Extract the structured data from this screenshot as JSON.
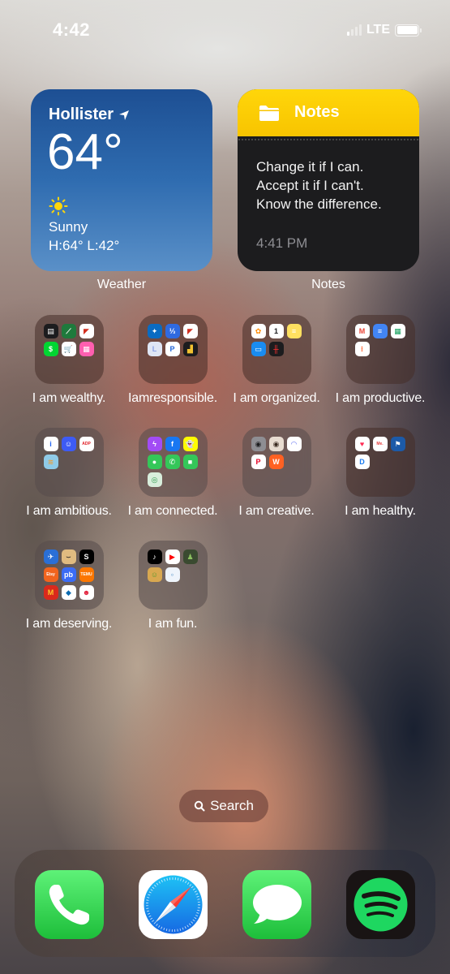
{
  "status_bar": {
    "time": "4:42",
    "network": "LTE",
    "signal_bars_active": 1,
    "signal_bars_total": 4,
    "battery_level": 1.0
  },
  "widgets": {
    "weather": {
      "city": "Hollister",
      "location_icon": "location-arrow-icon",
      "temperature": "64°",
      "condition_icon": "sun-icon",
      "condition": "Sunny",
      "high_low": "H:64° L:42°",
      "label": "Weather"
    },
    "notes": {
      "header": "Notes",
      "header_icon": "folder-icon",
      "lines": [
        "Change it if I can.",
        "Accept it if I can't.",
        "Know the difference."
      ],
      "timestamp": "4:41 PM",
      "label": "Notes"
    }
  },
  "folders": [
    {
      "label": "I am wealthy.",
      "apps": [
        {
          "name": "Wallet",
          "icon": "wallet-icon",
          "bg": "#1c1c1e",
          "glyph": "▤"
        },
        {
          "name": "Fifth Third Bank",
          "icon": "bank-icon",
          "bg": "#1e7a3c",
          "glyph": "⟋"
        },
        {
          "name": "Capital One",
          "icon": "capital-one-icon",
          "bg": "#ffffff",
          "glyph": "◤",
          "fg": "#d22e1e"
        },
        {
          "name": "Cash App",
          "icon": "cash-app-icon",
          "bg": "#00d632",
          "glyph": "$"
        },
        {
          "name": "Shopping Cart",
          "icon": "cart-icon",
          "bg": "#ffffff",
          "glyph": "🛒",
          "fg": "#2a4a8a"
        },
        {
          "name": "Store",
          "icon": "store-icon",
          "bg": "#ff5fb0",
          "glyph": "▦"
        }
      ]
    },
    {
      "label": "Iamresponsible.",
      "apps": [
        {
          "name": "Credit Karma",
          "icon": "shield-icon",
          "bg": "#0a6bc2",
          "glyph": "✦"
        },
        {
          "name": "Split",
          "icon": "split-icon",
          "bg": "#2f6ae0",
          "glyph": "⅓"
        },
        {
          "name": "Capital One",
          "icon": "capital-one-icon",
          "bg": "#ffffff",
          "glyph": "◤",
          "fg": "#d22e1e"
        },
        {
          "name": "L App",
          "icon": "l-icon",
          "bg": "#dfe6f5",
          "glyph": "L",
          "fg": "#8aa0e6"
        },
        {
          "name": "PayPal",
          "icon": "paypal-icon",
          "bg": "#ffffff",
          "glyph": "P",
          "fg": "#1f63d6"
        },
        {
          "name": "Chart App",
          "icon": "bar-chart-icon",
          "bg": "#1c1c1e",
          "glyph": "▟",
          "fg": "#f2c230"
        }
      ]
    },
    {
      "label": "I am organized.",
      "apps": [
        {
          "name": "Photos",
          "icon": "photos-icon",
          "bg": "#ffffff",
          "glyph": "✿",
          "fg": "#ff8a00"
        },
        {
          "name": "Calendar",
          "icon": "calendar-icon",
          "bg": "#ffffff",
          "glyph": "1",
          "fg": "#1c1c1e"
        },
        {
          "name": "Notes",
          "icon": "notes-icon",
          "bg": "#ffe060",
          "glyph": "≡",
          "fg": "#ffffff"
        },
        {
          "name": "Files",
          "icon": "files-icon",
          "bg": "#1a8cf0",
          "glyph": "▭"
        },
        {
          "name": "Voice Memos",
          "icon": "voice-memos-icon",
          "bg": "#1c1c1e",
          "glyph": "╫",
          "fg": "#ff3030"
        }
      ]
    },
    {
      "label": "I am productive.",
      "apps": [
        {
          "name": "Gmail",
          "icon": "gmail-icon",
          "bg": "#ffffff",
          "glyph": "M",
          "fg": "#ea4335"
        },
        {
          "name": "Google Docs",
          "icon": "docs-icon",
          "bg": "#4285f4",
          "glyph": "≡"
        },
        {
          "name": "Google Sheets",
          "icon": "sheets-icon",
          "bg": "#ffffff",
          "glyph": "▦",
          "fg": "#0f9d58"
        },
        {
          "name": "Reminders",
          "icon": "reminders-icon",
          "bg": "#ffffff",
          "glyph": "⁝",
          "fg": "#ff6b3a"
        }
      ]
    },
    {
      "label": "I am ambitious.",
      "apps": [
        {
          "name": "Indeed",
          "icon": "indeed-icon",
          "bg": "#ffffff",
          "glyph": "i",
          "fg": "#2164f3"
        },
        {
          "name": "Handshake",
          "icon": "robot-icon",
          "bg": "#3d5bf5",
          "glyph": "☺"
        },
        {
          "name": "ADP",
          "icon": "adp-icon",
          "bg": "#ffffff",
          "glyph": "ADP",
          "fg": "#e01b22"
        },
        {
          "name": "Planner",
          "icon": "planner-icon",
          "bg": "#8fcbe8",
          "glyph": "≋",
          "fg": "#e8a040"
        }
      ]
    },
    {
      "label": "I am connected.",
      "apps": [
        {
          "name": "Messenger",
          "icon": "messenger-icon",
          "bg": "#a24bf5",
          "glyph": "ϟ"
        },
        {
          "name": "Facebook",
          "icon": "facebook-icon",
          "bg": "#1877f2",
          "glyph": "f"
        },
        {
          "name": "Snapchat",
          "icon": "snapchat-icon",
          "bg": "#fffc00",
          "glyph": "👻",
          "fg": "#000"
        },
        {
          "name": "Messages",
          "icon": "messages-icon",
          "bg": "#34c759",
          "glyph": "●"
        },
        {
          "name": "Phone",
          "icon": "phone-icon",
          "bg": "#34c759",
          "glyph": "✆"
        },
        {
          "name": "FaceTime",
          "icon": "facetime-icon",
          "bg": "#34c759",
          "glyph": "■"
        },
        {
          "name": "Find My",
          "icon": "find-my-icon",
          "bg": "#d8eedc",
          "glyph": "◎",
          "fg": "#2b9a4a"
        }
      ]
    },
    {
      "label": "I am creative.",
      "apps": [
        {
          "name": "Camera",
          "icon": "camera-icon",
          "bg": "#8e8e93",
          "glyph": "◉",
          "fg": "#1c1c1e"
        },
        {
          "name": "Camera App",
          "icon": "vintage-camera-icon",
          "bg": "#e8dcd0",
          "glyph": "◉",
          "fg": "#3a2a20"
        },
        {
          "name": "Picsart",
          "icon": "picsart-icon",
          "bg": "#ffffff",
          "glyph": "◠",
          "fg": "#5b6bf0"
        },
        {
          "name": "Pinterest",
          "icon": "pinterest-icon",
          "bg": "#ffffff",
          "glyph": "P",
          "fg": "#e60023"
        },
        {
          "name": "Wattpad",
          "icon": "wattpad-icon",
          "bg": "#ff6122",
          "glyph": "W"
        }
      ]
    },
    {
      "label": "I am healthy.",
      "apps": [
        {
          "name": "Health",
          "icon": "health-icon",
          "bg": "#ffffff",
          "glyph": "♥",
          "fg": "#ff2d55"
        },
        {
          "name": "Me.",
          "icon": "me-icon",
          "bg": "#ffffff",
          "glyph": "Me.",
          "fg": "#e84040"
        },
        {
          "name": "Planet Fitness",
          "icon": "fitness-icon",
          "bg": "#1c5aa8",
          "glyph": "⚑"
        },
        {
          "name": "D App",
          "icon": "d-icon",
          "bg": "#ffffff",
          "glyph": "D",
          "fg": "#1a7bf0"
        }
      ]
    },
    {
      "label": "I am deserving.",
      "apps": [
        {
          "name": "Delivery",
          "icon": "delivery-icon",
          "bg": "#2a6fd6",
          "glyph": "✈"
        },
        {
          "name": "Amazon",
          "icon": "amazon-icon",
          "bg": "#e0bb80",
          "glyph": "⌣",
          "fg": "#1c1c1e"
        },
        {
          "name": "Shein",
          "icon": "shein-icon",
          "bg": "#000000",
          "glyph": "S"
        },
        {
          "name": "Etsy",
          "icon": "etsy-icon",
          "bg": "#f1641e",
          "glyph": "Etsy"
        },
        {
          "name": "Poshmark",
          "icon": "pb-icon",
          "bg": "#3b6cf5",
          "glyph": "pb"
        },
        {
          "name": "Temu",
          "icon": "temu-icon",
          "bg": "#fb7701",
          "glyph": "TEMU"
        },
        {
          "name": "McDonald's",
          "icon": "mcdonalds-icon",
          "bg": "#da291c",
          "glyph": "M",
          "fg": "#ffc72c"
        },
        {
          "name": "Domino's",
          "icon": "dominos-icon",
          "bg": "#ffffff",
          "glyph": "◆",
          "fg": "#0b6ab0"
        },
        {
          "name": "Wendy's",
          "icon": "wendys-icon",
          "bg": "#ffffff",
          "glyph": "☻",
          "fg": "#e2203c"
        }
      ]
    },
    {
      "label": "I am fun.",
      "apps": [
        {
          "name": "TikTok",
          "icon": "tiktok-icon",
          "bg": "#000000",
          "glyph": "♪"
        },
        {
          "name": "YouTube",
          "icon": "youtube-icon",
          "bg": "#ffffff",
          "glyph": "▶",
          "fg": "#ff0000"
        },
        {
          "name": "Chess",
          "icon": "chess-icon",
          "bg": "#3a4a30",
          "glyph": "♟",
          "fg": "#8cc060"
        },
        {
          "name": "Cut the Rope",
          "icon": "game-icon",
          "bg": "#d8a850",
          "glyph": "☺",
          "fg": "#5a9a30"
        },
        {
          "name": "Bubbles",
          "icon": "bubbles-icon",
          "bg": "#eef4fb",
          "glyph": "∘",
          "fg": "#9ac0e0"
        }
      ]
    }
  ],
  "search": {
    "label": "Search",
    "icon": "search-icon"
  },
  "dock": [
    {
      "name": "Phone",
      "icon": "phone-icon"
    },
    {
      "name": "Safari",
      "icon": "safari-icon"
    },
    {
      "name": "Messages",
      "icon": "messages-icon"
    },
    {
      "name": "Spotify",
      "icon": "spotify-icon"
    }
  ]
}
